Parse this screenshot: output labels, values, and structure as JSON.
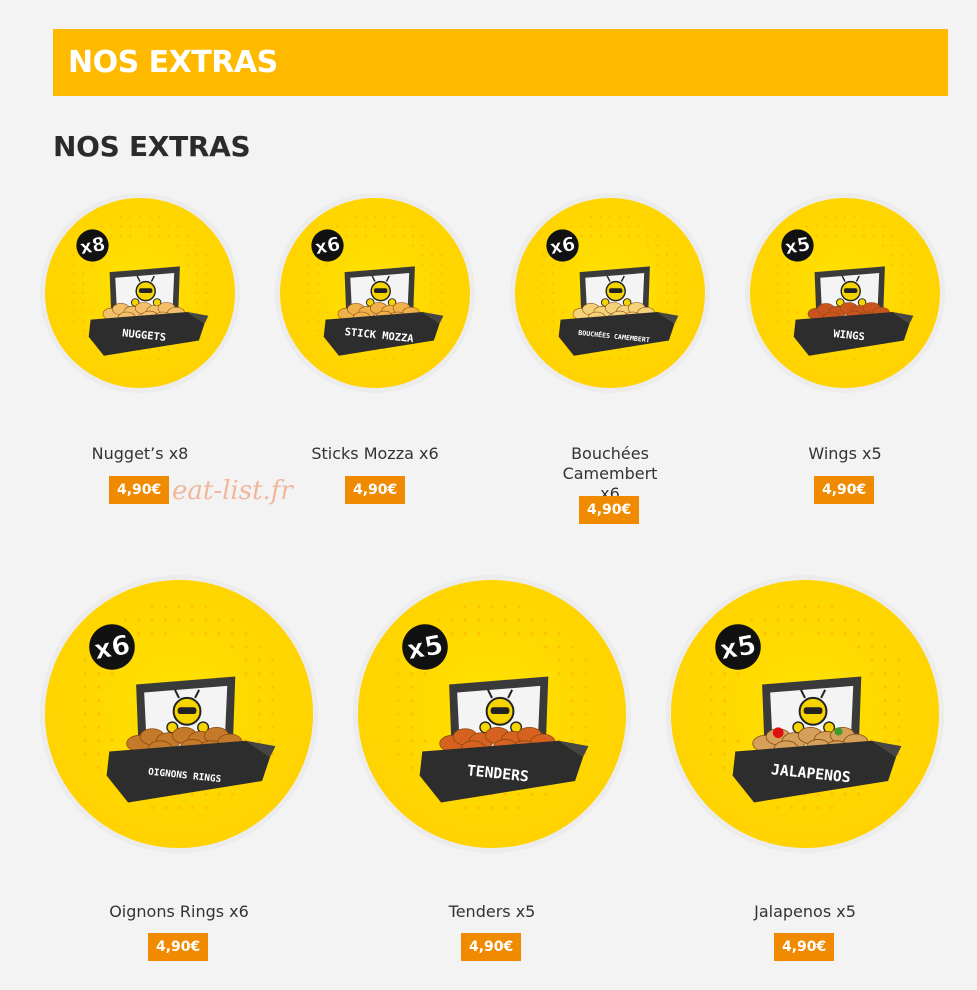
{
  "banner": {
    "title": "NOS EXTRAS"
  },
  "section": {
    "title": "NOS EXTRAS"
  },
  "watermark": "eat-list.fr",
  "products": [
    {
      "name": "Nugget’s x8",
      "price": "4,90€",
      "badge": "x8",
      "box_label": "NUGGETS"
    },
    {
      "name": "Sticks Mozza x6",
      "price": "4,90€",
      "badge": "x6",
      "box_label": "STICK MOZZA"
    },
    {
      "name": "Bouchées Camembert x6",
      "price": "4,90€",
      "badge": "x6",
      "box_label": "BOUCHÉES CAMEMBERT"
    },
    {
      "name": "Wings x5",
      "price": "4,90€",
      "badge": "x5",
      "box_label": "WINGS"
    },
    {
      "name": "Oignons Rings x6",
      "price": "4,90€",
      "badge": "x6",
      "box_label": "OIGNONS RINGS"
    },
    {
      "name": "Tenders x5",
      "price": "4,90€",
      "badge": "x5",
      "box_label": "TENDERS"
    },
    {
      "name": "Jalapenos x5",
      "price": "4,90€",
      "badge": "x5",
      "box_label": "JALAPENOS"
    }
  ],
  "colors": {
    "banner": "#ffba00",
    "price_tag": "#f08a00",
    "circle": "#ffd600"
  }
}
